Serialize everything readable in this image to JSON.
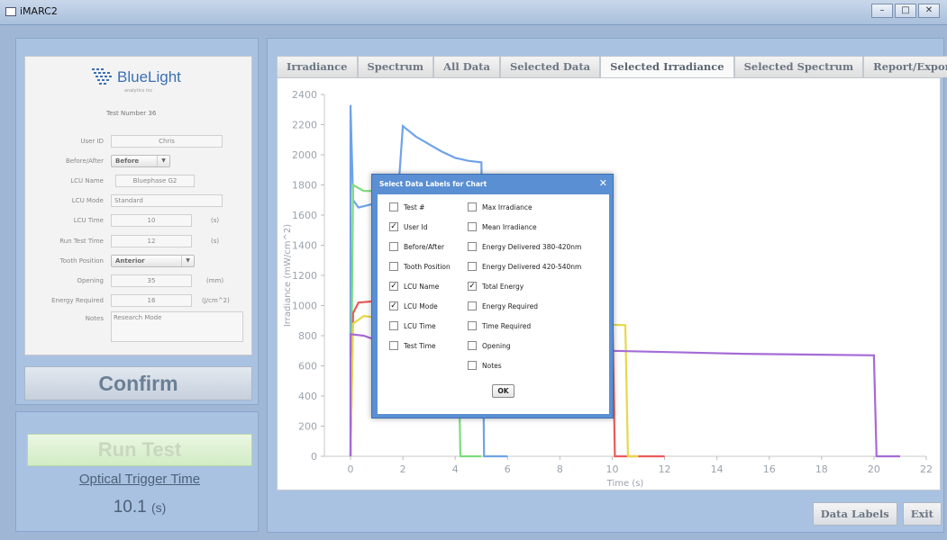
{
  "window": {
    "title": "iMARC2",
    "controls": [
      "–",
      "□",
      "✕"
    ]
  },
  "form": {
    "logo_text": "BlueLight",
    "logo_subtext": "analytics inc",
    "test_number_label": "Test Number",
    "test_number": "36",
    "fields": {
      "user_id": {
        "label": "User ID",
        "value": "Chris"
      },
      "before_after": {
        "label": "Before/After",
        "value": "Before"
      },
      "lcu_name": {
        "label": "LCU Name",
        "value": "Bluephase G2"
      },
      "lcu_mode": {
        "label": "LCU Mode",
        "value": "Standard"
      },
      "lcu_time": {
        "label": "LCU Time",
        "value": "10",
        "unit": "(s)"
      },
      "run_test_time": {
        "label": "Run Test Time",
        "value": "12",
        "unit": "(s)"
      },
      "tooth_position": {
        "label": "Tooth Position",
        "value": "Anterior"
      },
      "opening": {
        "label": "Opening",
        "value": "35",
        "unit": "(mm)"
      },
      "energy_required": {
        "label": "Energy Required",
        "value": "16",
        "unit": "(J/cm^2)"
      },
      "notes": {
        "label": "Notes",
        "value": "Research Mode"
      }
    },
    "confirm_label": "Confirm"
  },
  "run": {
    "run_test_label": "Run Test",
    "trigger_label": "Optical Trigger Time",
    "trigger_value": "10.1",
    "trigger_unit": "(s)"
  },
  "tabs": [
    {
      "label": "Irradiance",
      "active": false
    },
    {
      "label": "Spectrum",
      "active": false
    },
    {
      "label": "All Data",
      "active": false
    },
    {
      "label": "Selected Data",
      "active": false
    },
    {
      "label": "Selected Irradiance",
      "active": true
    },
    {
      "label": "Selected Spectrum",
      "active": false
    },
    {
      "label": "Report/Export",
      "active": false
    }
  ],
  "bottom_buttons": {
    "data_labels": "Data Labels",
    "exit": "Exit"
  },
  "dialog": {
    "title": "Select Data Labels for Chart",
    "close": "✕",
    "ok_label": "OK",
    "left_items": [
      {
        "label": "Test #",
        "checked": false
      },
      {
        "label": "User Id",
        "checked": true
      },
      {
        "label": "Before/After",
        "checked": false
      },
      {
        "label": "Tooth Position",
        "checked": false
      },
      {
        "label": "LCU Name",
        "checked": true
      },
      {
        "label": "LCU Mode",
        "checked": true
      },
      {
        "label": "LCU Time",
        "checked": false
      },
      {
        "label": "Test Time",
        "checked": false
      }
    ],
    "right_items": [
      {
        "label": "Max Irradiance",
        "checked": false
      },
      {
        "label": "Mean Irradiance",
        "checked": false
      },
      {
        "label": "Energy Delivered 380-420nm",
        "checked": false
      },
      {
        "label": "Energy Delivered 420-540nm",
        "checked": false
      },
      {
        "label": "Total Energy",
        "checked": true
      },
      {
        "label": "Energy Required",
        "checked": false
      },
      {
        "label": "Time Required",
        "checked": false
      },
      {
        "label": "Opening",
        "checked": false
      },
      {
        "label": "Notes",
        "checked": false
      }
    ]
  },
  "chart_data": {
    "type": "line",
    "xlabel": "Time (s)",
    "ylabel": "Irradiance (mW/cm^2)",
    "xlim": [
      -1,
      22
    ],
    "ylim": [
      0,
      2400
    ],
    "xticks": [
      0,
      2,
      4,
      6,
      8,
      10,
      12,
      14,
      16,
      18,
      20,
      22
    ],
    "yticks": [
      0,
      200,
      400,
      600,
      800,
      1000,
      1200,
      1400,
      1600,
      1800,
      2000,
      2200,
      2400
    ],
    "grid": false,
    "series": [
      {
        "color": "#6fa3e8",
        "points": [
          [
            0,
            0
          ],
          [
            0,
            2330
          ],
          [
            0.1,
            1700
          ],
          [
            0.3,
            1650
          ],
          [
            1,
            1680
          ],
          [
            1.8,
            1700
          ],
          [
            2,
            2190
          ],
          [
            2.5,
            2120
          ],
          [
            3,
            2070
          ],
          [
            3.5,
            2020
          ],
          [
            4,
            1980
          ],
          [
            4.5,
            1960
          ],
          [
            5,
            1950
          ],
          [
            5.1,
            0
          ],
          [
            6,
            0
          ]
        ]
      },
      {
        "color": "#7ddc7d",
        "points": [
          [
            0,
            0
          ],
          [
            0.1,
            1800
          ],
          [
            0.5,
            1760
          ],
          [
            2,
            1760
          ],
          [
            4,
            1760
          ],
          [
            4.2,
            0
          ],
          [
            5,
            0
          ]
        ]
      },
      {
        "color": "#ea5a5a",
        "points": [
          [
            0,
            0
          ],
          [
            0.1,
            950
          ],
          [
            0.3,
            1020
          ],
          [
            1,
            1030
          ],
          [
            3,
            1020
          ],
          [
            10,
            1000
          ],
          [
            10.1,
            0
          ],
          [
            12,
            0
          ]
        ]
      },
      {
        "color": "#e6d84a",
        "points": [
          [
            0,
            0
          ],
          [
            0.1,
            880
          ],
          [
            0.5,
            930
          ],
          [
            1,
            920
          ],
          [
            3,
            910
          ],
          [
            10.5,
            870
          ],
          [
            10.6,
            0
          ],
          [
            11,
            0
          ]
        ]
      },
      {
        "color": "#a56bd6",
        "points": [
          [
            0,
            0
          ],
          [
            0,
            810
          ],
          [
            0.5,
            800
          ],
          [
            1,
            770
          ],
          [
            5,
            760
          ],
          [
            10,
            700
          ],
          [
            15,
            680
          ],
          [
            20,
            670
          ],
          [
            20.1,
            0
          ],
          [
            21,
            0
          ]
        ]
      }
    ]
  }
}
